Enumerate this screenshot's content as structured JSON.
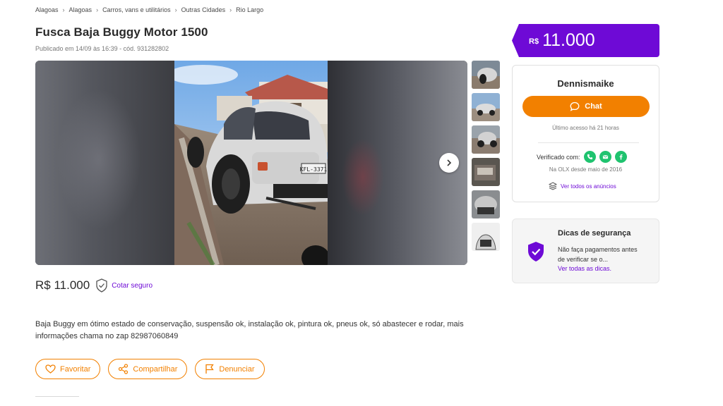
{
  "breadcrumb": [
    "Alagoas",
    "Alagoas",
    "Carros, vans e utilitários",
    "Outras Cidades",
    "Rio Largo"
  ],
  "listing": {
    "title": "Fusca Baja Buggy Motor 1500",
    "published": "Publicado em 14/09 às 16:39 - cód. 931282802",
    "price": "R$ 11.000",
    "safe_quote_link": "Cotar seguro",
    "description": "Baja Buggy em ótimo estado de conservação, suspensão ok, instalação ok, pintura ok, pneus ok, só abastecer e rodar, mais informações chama no zap 82987060849"
  },
  "gallery": {
    "plate_text": "KFL-3371",
    "thumbnail_count": 6
  },
  "actions": {
    "favorite": "Favoritar",
    "share": "Compartilhar",
    "report": "Denunciar"
  },
  "price_banner": {
    "currency": "R$",
    "value": "11.000"
  },
  "seller": {
    "name": "Dennismaike",
    "chat_label": "Chat",
    "last_access": "Último acesso há 21 horas",
    "verified_label": "Verificado com:",
    "verified_icons": [
      "phone-icon",
      "email-icon",
      "facebook-icon"
    ],
    "member_since": "Na OLX desde maio de 2016",
    "see_all_ads": "Ver todos os anúncios"
  },
  "safety": {
    "title": "Dicas de segurança",
    "text": "Não faça pagamentos antes de verificar se o...",
    "link": "Ver todas as dicas."
  },
  "colors": {
    "brand_purple": "#6e0ad6",
    "brand_orange": "#f28000",
    "verified_green": "#1fc36f"
  }
}
